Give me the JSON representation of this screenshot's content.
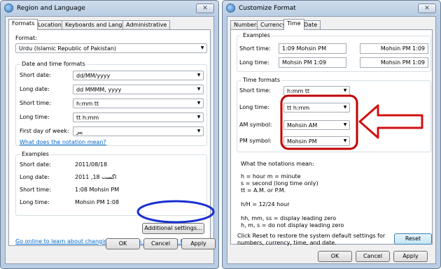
{
  "left_window": {
    "title": "Region and Language",
    "close_glyph": "✕",
    "tabs": [
      "Formats",
      "Location",
      "Keyboards and Languages",
      "Administrative"
    ],
    "format_label": "Format:",
    "format_value": "Urdu (Islamic Republic of Pakistan)",
    "date_time_group_title": "Date and time formats",
    "rows": [
      {
        "label": "Short date:",
        "value": "dd/MM/yyyy"
      },
      {
        "label": "Long date:",
        "value": "dd MMMM, yyyy"
      },
      {
        "label": "Short time:",
        "value": "h:mm tt"
      },
      {
        "label": "Long time:",
        "value": "tt h:mm"
      },
      {
        "label": "First day of week:",
        "value": "پیر"
      }
    ],
    "notation_link": "What does the notation mean?",
    "examples_group_title": "Examples",
    "examples": [
      {
        "label": "Short date:",
        "value": "2011/08/18"
      },
      {
        "label": "Long date:",
        "value": "2011 ,اگست 18"
      },
      {
        "label": "Short time:",
        "value": "1:08 Mohsin PM"
      },
      {
        "label": "Long time:",
        "value": "Mohsin PM 1:08"
      }
    ],
    "additional_settings": "Additional settings...",
    "online_link": "Go online to learn about changing languages and regional formats",
    "ok": "OK",
    "cancel": "Cancel",
    "apply": "Apply"
  },
  "right_window": {
    "title": "Customize Format",
    "close_glyph": "✕",
    "tabs": [
      "Numbers",
      "Currency",
      "Time",
      "Date"
    ],
    "examples_title": "Examples",
    "short_time_label": "Short time:",
    "short_time_ltr": "1:09 Mohsin PM",
    "short_time_rtl": "Mohsin PM 1:09",
    "long_time_label": "Long time:",
    "long_time_ltr": "Mohsin PM 1:09",
    "long_time_rtl": "Mohsin PM 1:09",
    "time_formats_title": "Time formats",
    "short_time_combo_label": "Short time:",
    "short_time_combo": "h:mm tt",
    "long_time_combo_label": "Long time:",
    "long_time_combo": "tt h:mm",
    "am_label": "AM symbol:",
    "am_value": "Mohsin AM",
    "pm_label": "PM symbol:",
    "pm_value": "Mohsin PM",
    "notations_title": "What the notations mean:",
    "notation_lines": [
      "h = hour   m = minute",
      "s = second (long time only)",
      "tt = A.M. or P.M.",
      "",
      "h/H = 12/24 hour",
      "",
      "hh, mm, ss = display leading zero",
      "h, m, s = do not display leading zero"
    ],
    "reset_text_line1": "Click Reset to restore the system default settings for",
    "reset_text_line2": "numbers, currency, time, and date.",
    "reset": "Reset",
    "ok": "OK",
    "cancel": "Cancel",
    "apply": "Apply"
  },
  "annotations": {
    "highlight_color": "#c00000",
    "ellipse_color": "#1a2fd0"
  }
}
